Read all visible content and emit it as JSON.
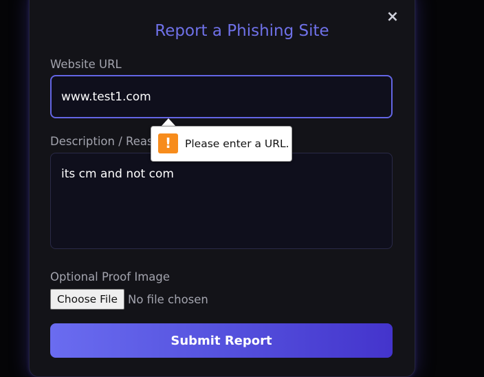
{
  "modal": {
    "title": "Report a Phishing Site",
    "close_symbol": "×",
    "close_icon": "close-icon"
  },
  "form": {
    "url_label": "Website URL",
    "url_value": "www.test1.com",
    "description_label": "Description / Reason",
    "description_value": "its cm and not com",
    "proof_label": "Optional Proof Image",
    "choose_file_label": "Choose File",
    "file_status": "No file chosen",
    "submit_label": "Submit Report"
  },
  "validation_tooltip": {
    "icon_symbol": "!",
    "icon": "warning-icon",
    "message": "Please enter a URL."
  },
  "colors": {
    "accent": "#6466e6",
    "title": "#6f71e8",
    "warning": "#f78c1c"
  }
}
